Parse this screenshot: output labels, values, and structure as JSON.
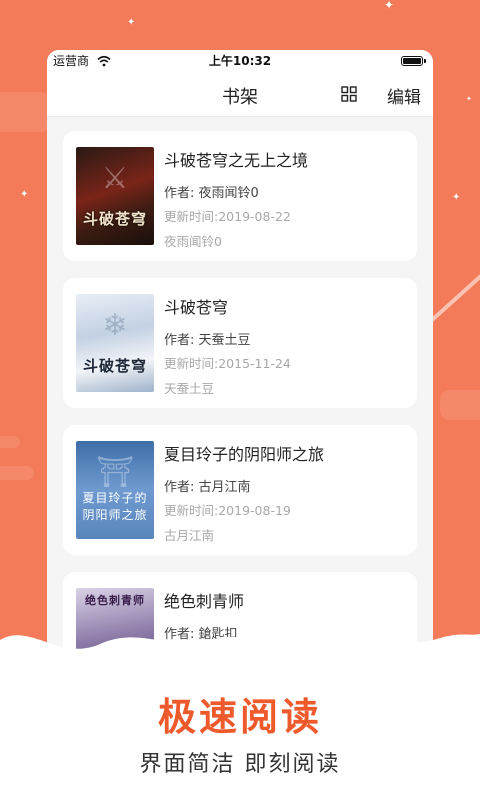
{
  "colors": {
    "accent": "#f47b59",
    "slogan": "#ef5a2c"
  },
  "statusbar": {
    "carrier": "运营商",
    "time": "上午10:32"
  },
  "navbar": {
    "title": "书架",
    "edit_label": "编辑"
  },
  "books": [
    {
      "title": "斗破苍穹之无上之境",
      "author": "作者: 夜雨闻铃0",
      "updated": "更新时间:2019-08-22",
      "chapter": "夜雨闻铃0",
      "cover_text": "斗破苍穹"
    },
    {
      "title": "斗破苍穹",
      "author": "作者: 天蚕土豆",
      "updated": "更新时间:2015-11-24",
      "chapter": "天蚕土豆",
      "cover_text": "斗破苍穹"
    },
    {
      "title": "夏目玲子的阴阳师之旅",
      "author": "作者: 古月江南",
      "updated": "更新时间:2019-08-19",
      "chapter": "古月江南",
      "cover_text": "夏目玲子的阴阳师之旅"
    },
    {
      "title": "绝色刺青师",
      "author": "作者: 鎗匙扣",
      "updated": "",
      "chapter": "",
      "cover_text": "绝色刺青师"
    }
  ],
  "promo": {
    "slogan": "极速阅读",
    "subslogan": "界面简洁   即刻阅读"
  }
}
